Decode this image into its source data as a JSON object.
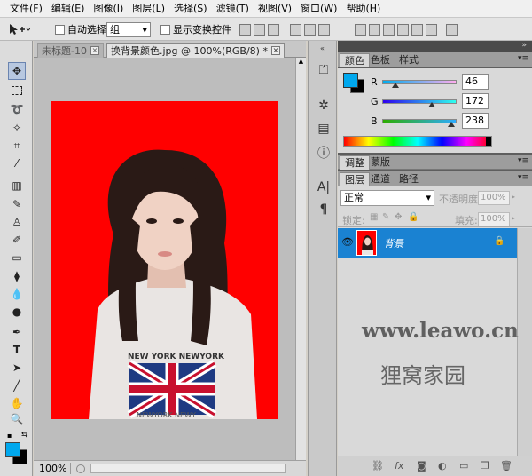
{
  "menu": [
    "文件(F)",
    "编辑(E)",
    "图像(I)",
    "图层(L)",
    "选择(S)",
    "滤镜(T)",
    "视图(V)",
    "窗口(W)",
    "帮助(H)"
  ],
  "options": {
    "auto_select_label": "自动选择:",
    "auto_select_value": "组",
    "show_transform_label": "显示变换控件"
  },
  "tabs": {
    "untitled": "未标题-10",
    "document": "换背景颜色.jpg @ 100%(RGB/8) *"
  },
  "status": {
    "zoom": "100%"
  },
  "color_panel": {
    "tabs": [
      "颜色",
      "色板",
      "样式"
    ],
    "foreground": "#00a8ee",
    "background": "#000000",
    "r_label": "R",
    "r_value": "46",
    "g_label": "G",
    "g_value": "172",
    "b_label": "B",
    "b_value": "238",
    "r_fraction": 0.18,
    "g_fraction": 0.67,
    "b_fraction": 0.93
  },
  "adjust_tabs": [
    "调整",
    "蒙版"
  ],
  "layers_panel": {
    "tabs": [
      "图层",
      "通道",
      "路径"
    ],
    "blend_mode": "正常",
    "opacity_label": "不透明度:",
    "opacity_value": "100%",
    "lock_label": "锁定:",
    "fill_label": "填充:",
    "fill_value": "100%",
    "layer_name": "背景"
  },
  "watermark": {
    "url": "www.leawo.cn",
    "name": "狸窝家园"
  },
  "colors": {
    "canvas_bg": "#ff0000",
    "layer_selected": "#1a82d2",
    "foreground": "#00a8ee"
  }
}
